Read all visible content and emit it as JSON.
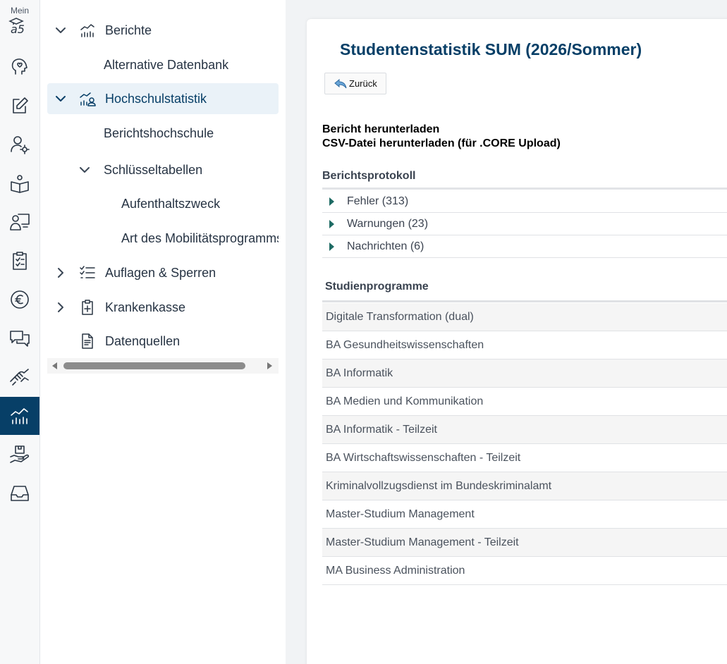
{
  "rail": {
    "logo_text": "Mein",
    "items": [
      {
        "icon": "head-heart-icon"
      },
      {
        "icon": "edit-icon"
      },
      {
        "icon": "user-settings-icon"
      },
      {
        "icon": "book-icon"
      },
      {
        "icon": "teacher-board-icon"
      },
      {
        "icon": "clipboard-check-icon"
      },
      {
        "icon": "euro-icon"
      },
      {
        "icon": "chat-bubbles-icon"
      },
      {
        "icon": "handshake-icon"
      },
      {
        "icon": "statistics-icon",
        "active": true
      },
      {
        "icon": "hand-package-icon"
      },
      {
        "icon": "inbox-icon"
      }
    ]
  },
  "tree": {
    "items": [
      {
        "label": "Berichte",
        "expanded": true,
        "icon": "chart-icon"
      },
      {
        "label": "Alternative Datenbank"
      },
      {
        "label": "Hochschulstatistik",
        "expanded": true,
        "selected": true,
        "icon": "chart-person-icon"
      },
      {
        "label": "Berichtshochschule"
      },
      {
        "label": "Schlüsseltabellen",
        "expanded": true
      },
      {
        "label": "Aufenthaltszweck"
      },
      {
        "label": "Art des Mobilitätsprogramms"
      },
      {
        "label": "Auflagen & Sperren",
        "expanded": false,
        "icon": "checklist-icon"
      },
      {
        "label": "Krankenkasse",
        "expanded": false,
        "icon": "medical-clipboard-icon"
      },
      {
        "label": "Datenquellen",
        "icon": "document-icon"
      }
    ]
  },
  "content": {
    "title": "Studentenstatistik SUM (2026/Sommer)",
    "back_label": "Zurück",
    "download_report": "Bericht herunterladen",
    "download_csv": "CSV-Datei herunterladen (für .CORE Upload)",
    "protocol_title": "Berichtsprotokoll",
    "protocol_items": [
      "Fehler (313)",
      "Warnungen (23)",
      "Nachrichten (6)"
    ],
    "programs_title": "Studienprogramme",
    "programs": [
      "Digitale Transformation (dual)",
      "BA Gesundheitswissenschaften",
      "BA Informatik",
      "BA Medien und Kommunikation",
      "BA Informatik - Teilzeit",
      "BA Wirtschaftswissenschaften - Teilzeit",
      "Kriminalvollzugsdienst im Bundeskriminalamt",
      "Master-Studium Management",
      "Master-Studium Management - Teilzeit",
      "MA Business Administration"
    ]
  },
  "colors": {
    "accent": "#073f67",
    "selected_bg": "#eaf2f8",
    "triangle": "#1e6b64"
  }
}
